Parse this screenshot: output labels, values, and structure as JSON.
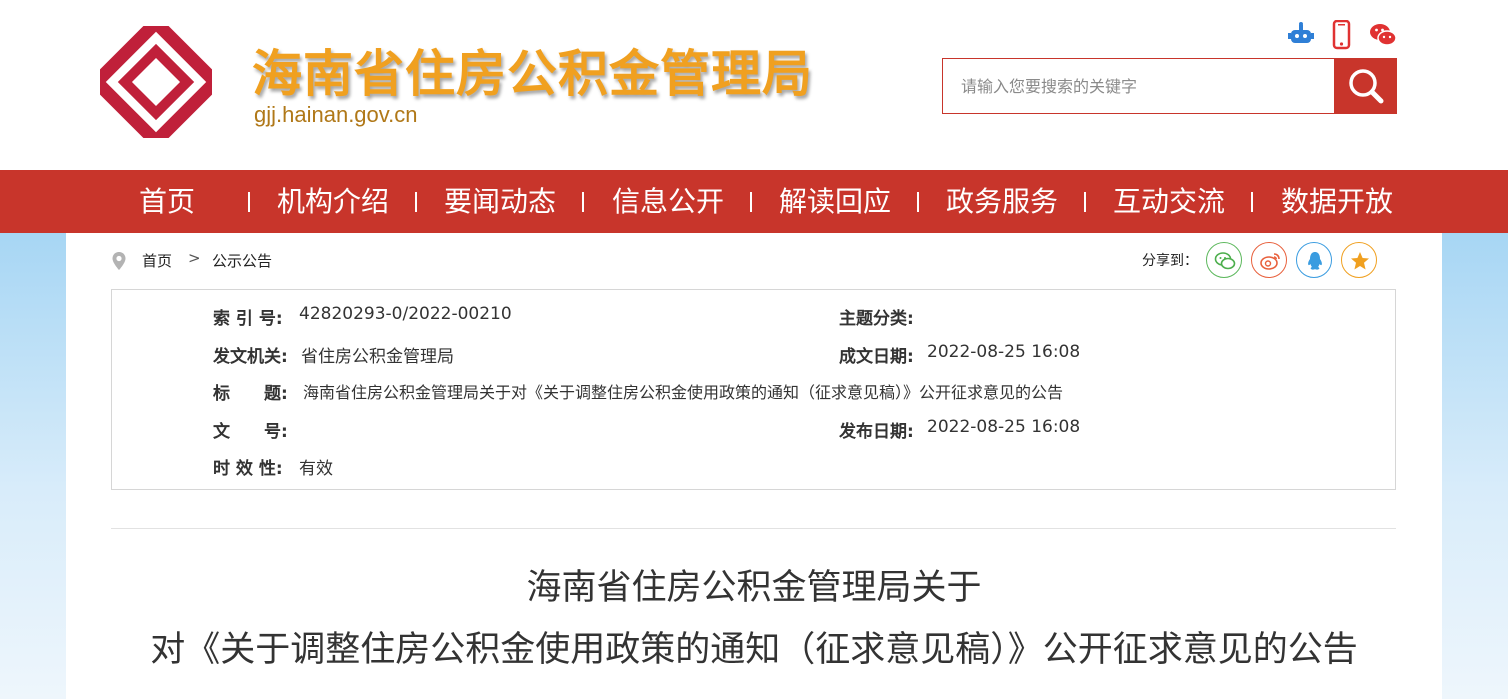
{
  "header": {
    "site_title": "海南省住房公积金管理局",
    "site_domain": "gjj.hainan.gov.cn",
    "search_placeholder": "请输入您要搜索的关键字",
    "icons": [
      "robot-icon",
      "mobile-phone-icon",
      "wechat-icon",
      "search-icon"
    ]
  },
  "nav": {
    "items": [
      "首页",
      "机构介绍",
      "要闻动态",
      "信息公开",
      "解读回应",
      "政务服务",
      "互动交流",
      "数据开放"
    ]
  },
  "breadcrumb": {
    "home": "首页",
    "sep": ">",
    "current": "公示公告"
  },
  "share": {
    "label": "分享到：",
    "targets": [
      "wechat",
      "weibo",
      "qq",
      "qzone"
    ]
  },
  "meta": {
    "index_label": "索 引 号:",
    "index_value": "42820293-0/2022-00210",
    "topic_label": "主题分类:",
    "topic_value": "",
    "issuer_label": "发文机关:",
    "issuer_value": "省住房公积金管理局",
    "created_label": "成文日期:",
    "created_value": "2022-08-25 16:08",
    "title_label": "标　　题:",
    "title_value": "海南省住房公积金管理局关于对《关于调整住房公积金使用政策的通知（征求意见稿）》公开征求意见的公告",
    "docno_label": "文　　号:",
    "docno_value": "",
    "published_label": "发布日期:",
    "published_value": "2022-08-25 16:08",
    "validity_label": "时 效 性:",
    "validity_value": "有效"
  },
  "article": {
    "title_line1": "海南省住房公积金管理局关于",
    "title_line2": "对《关于调整住房公积金使用政策的通知（征求意见稿）》公开征求意见的公告"
  },
  "colors": {
    "brand_red": "#c8352b",
    "title_gold": "#f0a020",
    "domain_brown": "#b07818",
    "side_blue": "#a7d6f4"
  }
}
